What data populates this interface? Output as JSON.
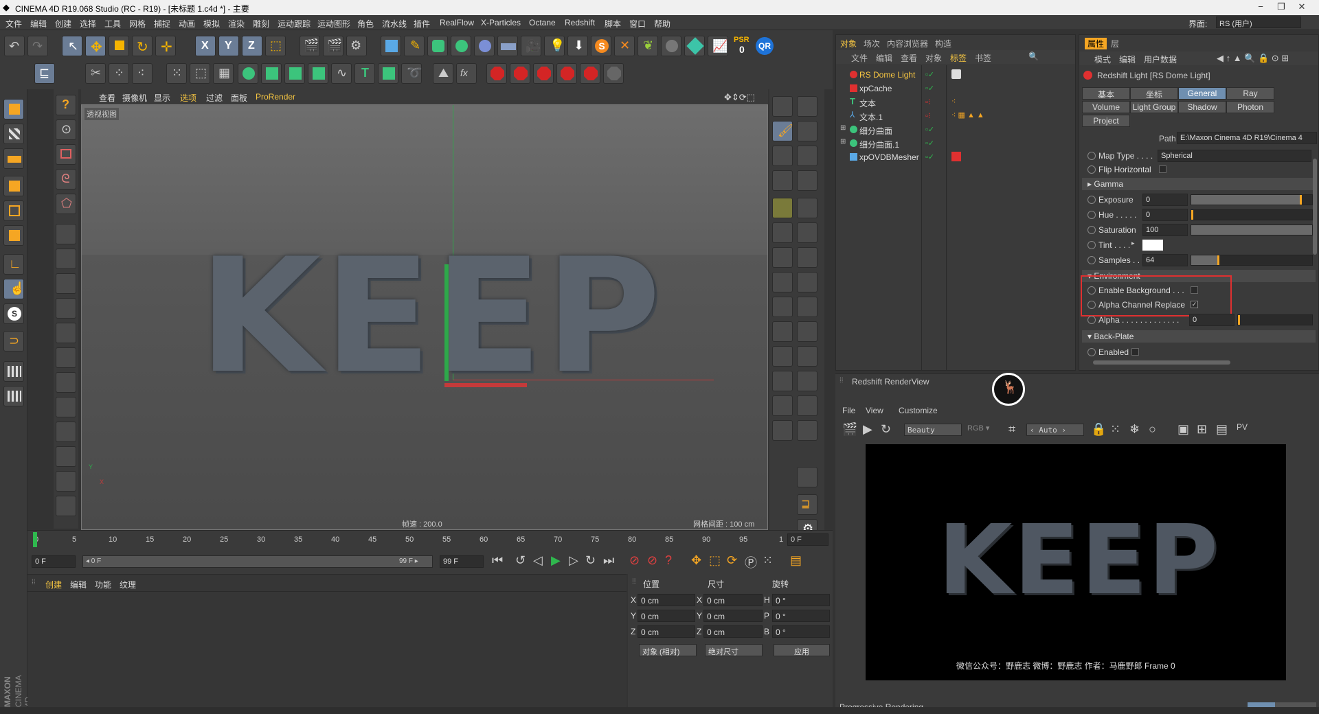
{
  "window": {
    "title": "CINEMA 4D R19.068 Studio (RC - R19) - [未标题 1.c4d *] - 主要",
    "interface_label": "界面:",
    "interface_value": "RS (用户)",
    "minimize": "−",
    "maximize": "❐",
    "close": "✕"
  },
  "menu": [
    "文件",
    "编辑",
    "创建",
    "选择",
    "工具",
    "网格",
    "捕捉",
    "动画",
    "模拟",
    "渲染",
    "雕刻",
    "运动跟踪",
    "运动图形",
    "角色",
    "流水线",
    "插件",
    "RealFlow",
    "X-Particles",
    "Octane",
    "Redshift",
    "脚本",
    "窗口",
    "帮助"
  ],
  "toolbar": {
    "x_label": "X",
    "y_label": "Y",
    "z_label": "Z",
    "psr_label": "PSR",
    "psr_value": "0",
    "qr_label": "QR"
  },
  "viewport": {
    "menu": [
      "查看",
      "摄像机",
      "显示",
      "选项",
      "过滤",
      "面板",
      "ProRender"
    ],
    "name": "透视视图",
    "fps": "帧速 : 200.0",
    "grid": "网格间距 : 100 cm",
    "text3d": "KEEP",
    "axis_y": "Y",
    "axis_x": "X"
  },
  "timeline": {
    "ticks": [
      "0",
      "5",
      "10",
      "15",
      "20",
      "25",
      "30",
      "35",
      "40",
      "45",
      "50",
      "55",
      "60",
      "65",
      "70",
      "75",
      "80",
      "85",
      "90",
      "95",
      "1"
    ],
    "frame_right": "0 F"
  },
  "transport": {
    "start": "0 F",
    "range_start": "◂ 0 F",
    "range_end": "99 F ▸",
    "end": "99 F"
  },
  "material": {
    "menu": [
      "创建",
      "编辑",
      "功能",
      "纹理"
    ]
  },
  "coords": {
    "headers": [
      "位置",
      "尺寸",
      "旋转"
    ],
    "rows": [
      {
        "axis": "X",
        "pos": "0 cm",
        "size": "0 cm",
        "rot_label": "H",
        "rot": "0 °"
      },
      {
        "axis": "Y",
        "pos": "0 cm",
        "size": "0 cm",
        "rot_label": "P",
        "rot": "0 °"
      },
      {
        "axis": "Z",
        "pos": "0 cm",
        "size": "0 cm",
        "rot_label": "B",
        "rot": "0 °"
      }
    ],
    "mode": "对象 (相对)",
    "size_mode": "绝对尺寸",
    "apply": "应用"
  },
  "objects": {
    "tabs": [
      "对象",
      "场次",
      "内容浏览器",
      "构造"
    ],
    "menu": [
      "文件",
      "编辑",
      "查看",
      "对象",
      "标签",
      "书签"
    ],
    "items": [
      {
        "name": "RS Dome Light",
        "highlight": true
      },
      {
        "name": "xpCache",
        "highlight": false
      },
      {
        "name": "文本",
        "highlight": false
      },
      {
        "name": "文本.1",
        "highlight": false
      },
      {
        "name": "细分曲面",
        "highlight": false
      },
      {
        "name": "细分曲面.1",
        "highlight": false
      },
      {
        "name": "xpOVDBMesher",
        "highlight": false
      }
    ]
  },
  "attributes": {
    "tabs": [
      "属性",
      "层"
    ],
    "menu": [
      "模式",
      "编辑",
      "用户数据"
    ],
    "title": "Redshift Light [RS Dome Light]",
    "tab_rows": [
      [
        "基本",
        "坐标",
        "General",
        "Ray"
      ],
      [
        "Volume",
        "Light Group",
        "Shadow",
        "Photon"
      ],
      [
        "Project"
      ]
    ],
    "path_label": "Path",
    "path_value": "E:\\Maxon Cinema 4D R19\\Cinema 4",
    "map_type_label": "Map Type . . . .",
    "map_type_value": "Spherical",
    "flip_label": "Flip Horizontal",
    "gamma_label": "▸ Gamma",
    "exposure_label": "Exposure",
    "exposure_value": "0",
    "hue_label": "Hue . . . . .",
    "hue_value": "0",
    "saturation_label": "Saturation",
    "saturation_value": "100",
    "saturation_fraction": 1.0,
    "tint_label": "Tint . . . .",
    "samples_label": "Samples . .",
    "samples_value": "64",
    "environment_label": "▾ Environment",
    "enable_bg_label": "Enable Background . . .",
    "alpha_channel_label": "Alpha Channel Replace",
    "alpha_label": "Alpha . . . . . . . . . . . . .",
    "alpha_value": "0",
    "backplate_label": "▾ Back-Plate",
    "enabled_label": "Enabled"
  },
  "renderview": {
    "title": "Redshift RenderView",
    "menu": [
      "File",
      "View",
      "Customize"
    ],
    "aov": "Beauty",
    "zoom": "‹ Auto ›",
    "render_text": "KEEP",
    "caption": "微信公众号：野鹿志   微博：野鹿志   作者：马鹿野郎  Frame  0",
    "status": "Progressive Rendering...",
    "progress_fraction": 0.4
  },
  "brand": {
    "line1": "MAXON",
    "line2": "CINEMA 4D"
  },
  "colors": {
    "accent": "#6f8fb0",
    "highlight_red": "#e03030",
    "selected_text": "#f5c542"
  }
}
